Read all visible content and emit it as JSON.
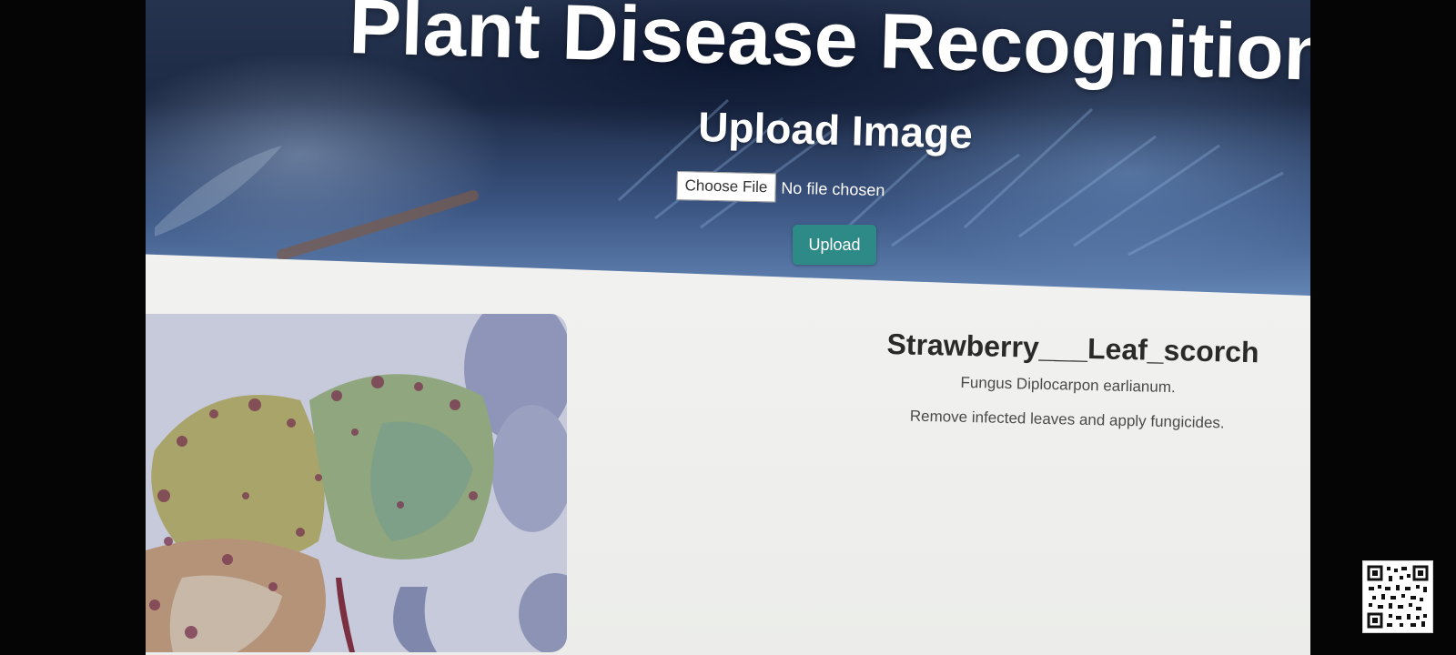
{
  "hero": {
    "title": "Plant Disease Recognition",
    "upload_heading": "Upload Image",
    "choose_file_label": "Choose File",
    "file_status": "No file chosen",
    "upload_button": "Upload"
  },
  "result": {
    "disease_name": "Strawberry___Leaf_scorch",
    "cause": "Fungus Diplocarpon earlianum.",
    "remedy": "Remove infected leaves and apply fungicides."
  },
  "colors": {
    "upload_button_bg": "#2e8a86",
    "hero_bg": "#2a3b5c",
    "page_bg": "#f3f4f1"
  },
  "icons": {
    "overlay": "qr-code-icon"
  }
}
